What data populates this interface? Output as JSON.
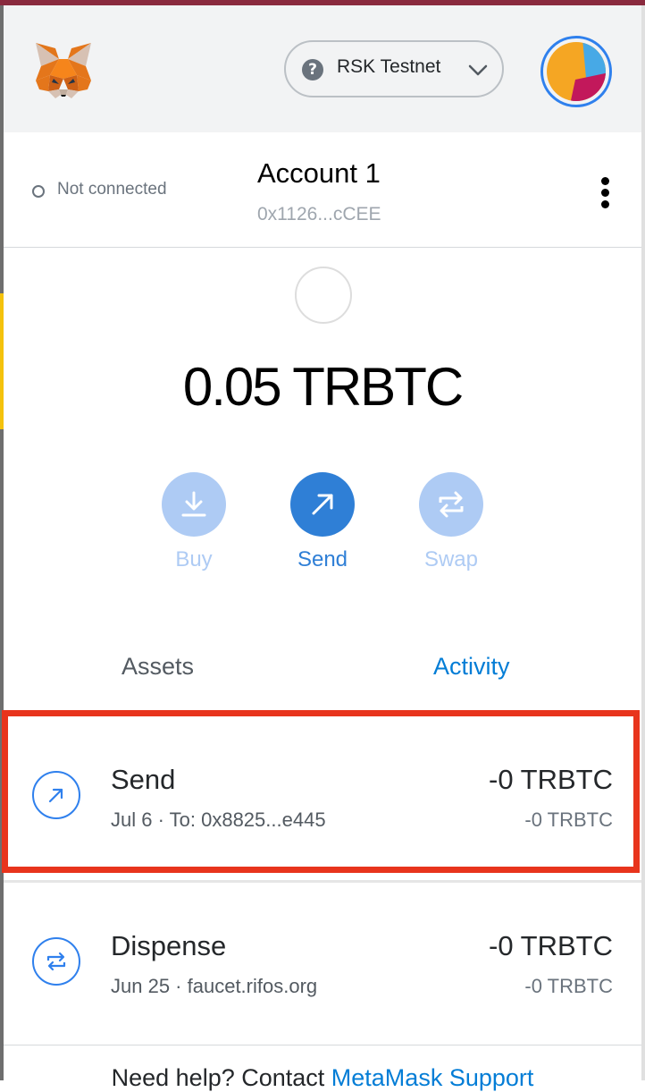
{
  "header": {
    "network": {
      "name": "RSK Testnet",
      "help_icon": "question-mark-icon",
      "dropdown_icon": "chevron-down-icon"
    },
    "logo_icon": "metamask-fox-icon",
    "avatar_colors": [
      "#f5a623",
      "#47a9e6",
      "#c2185b"
    ]
  },
  "account": {
    "connection_status": "Not connected",
    "name": "Account 1",
    "address": "0x1126...cCEE",
    "menu_icon": "kebab-menu-icon"
  },
  "balance": {
    "amount": "0.05 TRBTC"
  },
  "actions": {
    "buy": {
      "label": "Buy",
      "icon": "download-icon"
    },
    "send": {
      "label": "Send",
      "icon": "arrow-up-right-icon"
    },
    "swap": {
      "label": "Swap",
      "icon": "swap-arrows-icon"
    }
  },
  "tabs": {
    "assets": "Assets",
    "activity": "Activity"
  },
  "activity": [
    {
      "title": "Send",
      "date": "Jul 6",
      "detail": "To: 0x8825...e445",
      "amount": "-0 TRBTC",
      "amount_secondary": "-0 TRBTC",
      "icon": "arrow-up-right-icon"
    },
    {
      "title": "Dispense",
      "date": "Jun 25",
      "detail": "faucet.rifos.org",
      "amount": "-0 TRBTC",
      "amount_secondary": "-0 TRBTC",
      "icon": "swap-arrows-icon"
    }
  ],
  "footer": {
    "help_text": "Need help? Contact ",
    "help_link": "MetaMask Support"
  },
  "colors": {
    "accent": "#037dd6",
    "send_button": "#2f80ed",
    "disabled_button": "#aecbf4",
    "highlight": "#e8341c"
  }
}
